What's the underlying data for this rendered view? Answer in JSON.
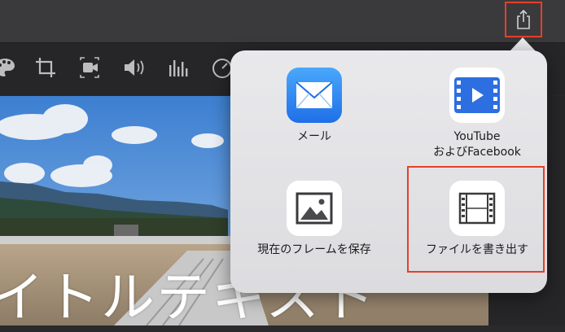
{
  "header": {
    "share_icon": "share-icon"
  },
  "toolbar": {
    "tools": [
      "color-palette-icon",
      "crop-icon",
      "camera-stabilize-icon",
      "volume-icon",
      "equalizer-icon",
      "speed-icon"
    ]
  },
  "viewer": {
    "title_text": "イトルテキスト"
  },
  "share_menu": {
    "items": [
      {
        "label": "メール",
        "icon": "mail-icon"
      },
      {
        "label": "YouTube\nおよびFacebook",
        "icon": "youtube-facebook-icon"
      },
      {
        "label": "現在のフレームを保存",
        "icon": "image-icon"
      },
      {
        "label": "ファイルを書き出す",
        "icon": "film-icon"
      }
    ]
  },
  "colors": {
    "highlight": "#e5402a",
    "mail_blue": "#2f8cf6",
    "video_blue": "#2d6fe0"
  }
}
